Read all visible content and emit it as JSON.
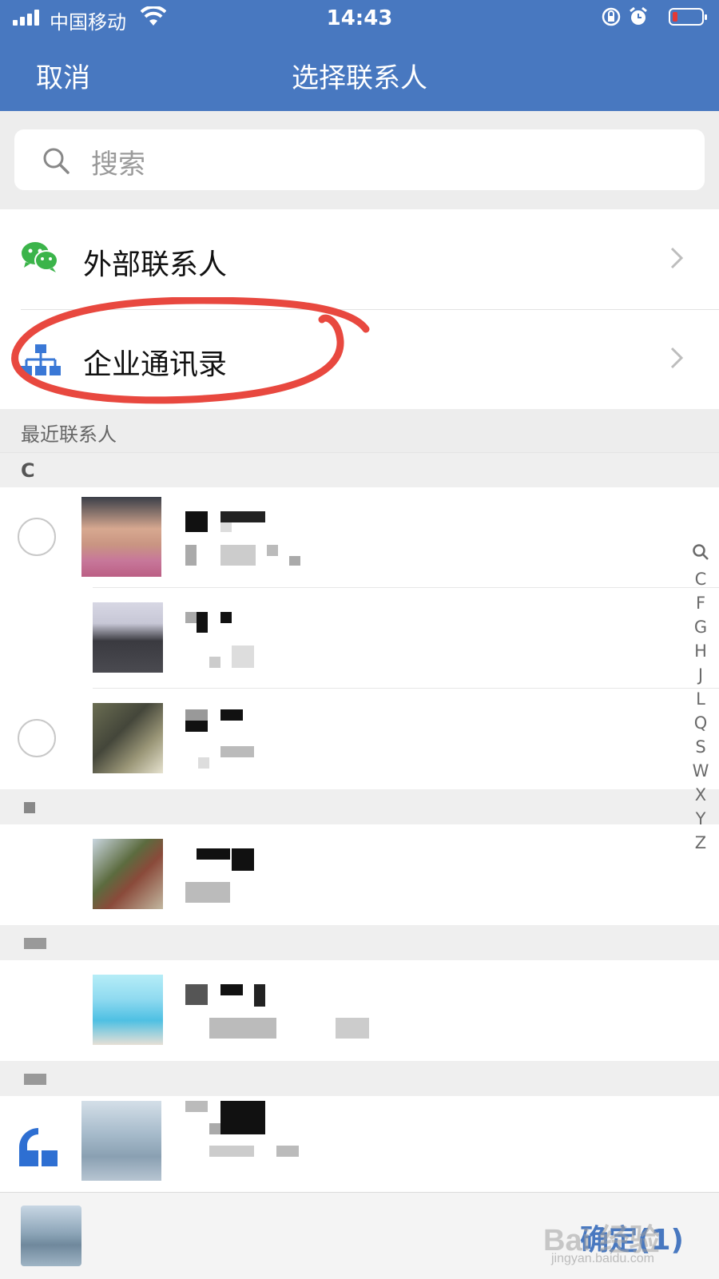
{
  "status_bar": {
    "carrier": "中国移动",
    "time": "14:43",
    "battery_level": 0.1,
    "battery_color": "#e53935"
  },
  "nav": {
    "cancel_label": "取消",
    "title": "选择联系人",
    "bar_color": "#4878c0"
  },
  "search": {
    "placeholder": "搜索"
  },
  "menu": [
    {
      "label": "外部联系人",
      "icon": "wechat-icon"
    },
    {
      "label": "企业通讯录",
      "icon": "org-chart-icon",
      "annotated": true
    }
  ],
  "recent_header": "最近联系人",
  "sections": [
    {
      "letter": "C"
    }
  ],
  "index_letters": [
    "C",
    "F",
    "G",
    "H",
    "J",
    "L",
    "Q",
    "S",
    "W",
    "X",
    "Y",
    "Z"
  ],
  "bottom_bar": {
    "confirm_label": "确定(1)",
    "watermark": "Bai 经验",
    "watermark_sub": "jingyan.baidu.com"
  }
}
